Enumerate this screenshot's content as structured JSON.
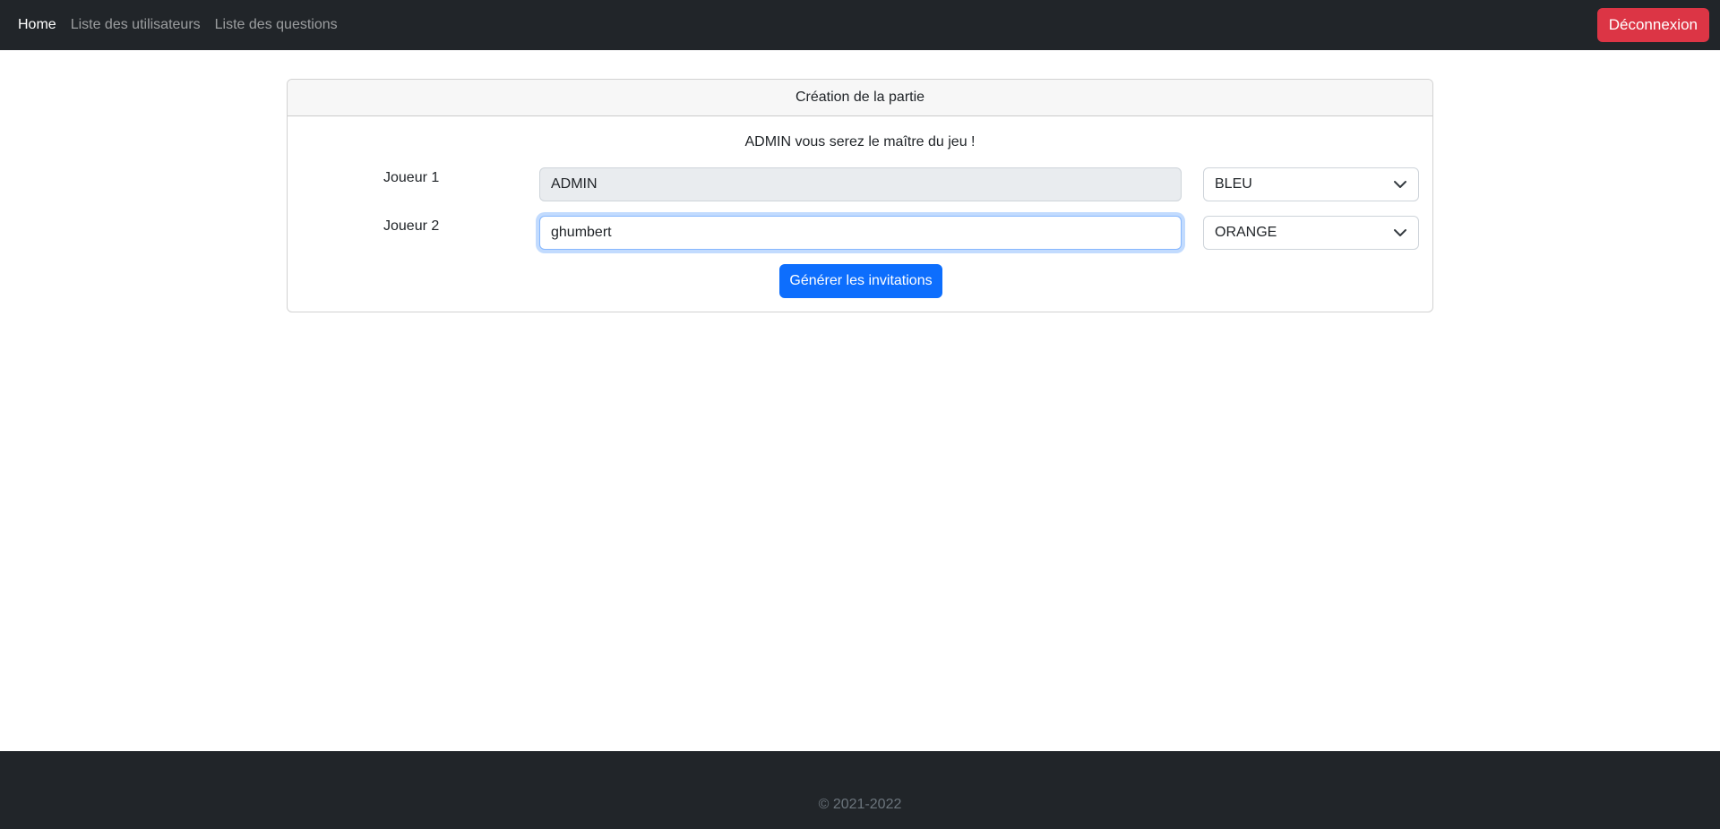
{
  "nav": {
    "home": "Home",
    "users": "Liste des utilisateurs",
    "questions": "Liste des questions",
    "logout": "Déconnexion"
  },
  "card": {
    "title": "Création de la partie",
    "intro": "ADMIN vous serez le maître du jeu !",
    "player1": {
      "label": "Joueur 1",
      "value": "ADMIN",
      "color": "BLEU"
    },
    "player2": {
      "label": "Joueur 2",
      "value": "ghumbert",
      "color": "ORANGE"
    },
    "submit": "Générer les invitations"
  },
  "footer": {
    "copyright": "© 2021-2022"
  },
  "colors": {
    "navbar": "#212529",
    "danger": "#dc3545",
    "primary": "#0d6efd"
  }
}
